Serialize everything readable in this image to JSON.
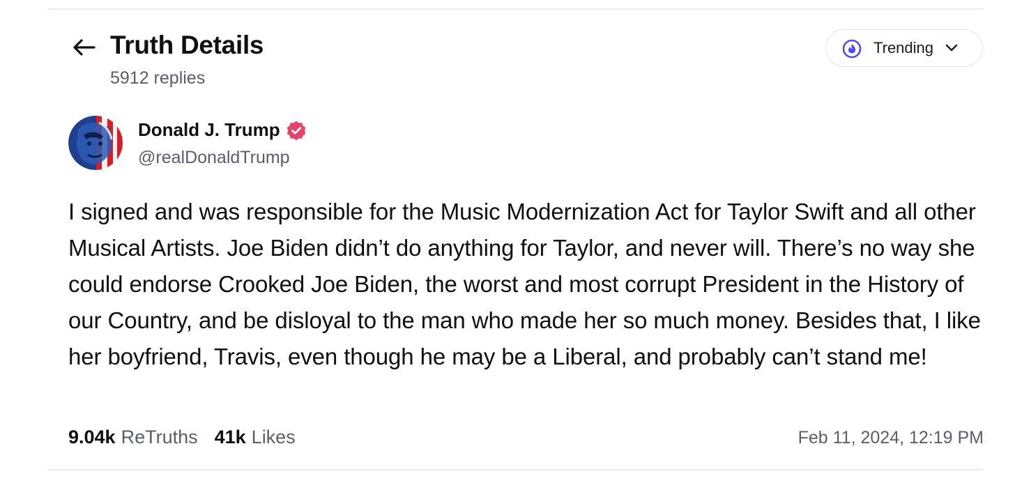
{
  "header": {
    "title": "Truth Details",
    "replies": "5912 replies",
    "back_icon": "arrow-left-icon"
  },
  "sort": {
    "label": "Trending",
    "icon": "flame-icon",
    "chevron_icon": "chevron-down-icon",
    "accent_color": "#5448ee"
  },
  "post": {
    "author": {
      "name": "Donald J. Trump",
      "handle": "@realDonaldTrump",
      "verified_color": "#e64369"
    },
    "text": "I signed and was responsible for the Music Modernization Act for Taylor Swift and all other Musical Artists. Joe Biden didn’t do anything for Taylor, and never will. There’s no way she could endorse Crooked Joe Biden, the worst and most corrupt President in the History of our Country, and be disloyal to the man who made her so much money. Besides that, I like her boyfriend, Travis, even though he may be a Liberal, and probably can’t stand me!",
    "stats": {
      "retruths_count": "9.04k",
      "retruths_label": "ReTruths",
      "likes_count": "41k",
      "likes_label": "Likes"
    },
    "timestamp": "Feb 11, 2024, 12:19 PM"
  }
}
